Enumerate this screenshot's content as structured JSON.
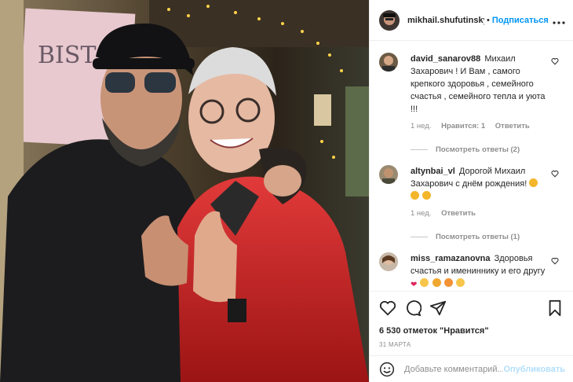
{
  "header": {
    "username": "mikhail.shufutinsky",
    "separator": "•",
    "follow_label": "Подписаться",
    "more_icon": "more-horizontal-icon"
  },
  "comments": [
    {
      "username": "david_sanarov88",
      "text": "Михаил Захарович ! И Вам , самого крепкого здоровья , семейного счастья , семейного тепла и уюта !!!",
      "time": "1 нед.",
      "likes": "Нравится: 1",
      "reply": "Ответить",
      "replies": "Посмотреть ответы (2)"
    },
    {
      "username": "altynbai_vl",
      "text": "Дорогой Михаил Захарович с днём рождения!",
      "emoji": [
        "clap",
        "clap",
        "clap"
      ],
      "time": "1 нед.",
      "reply": "Ответить",
      "replies": "Посмотреть ответы (1)"
    },
    {
      "username": "miss_ramazanovna",
      "text": "Здоровья счастья и имениннику и его другу",
      "emoji": [
        "heart",
        "scream",
        "hug",
        "heart-face",
        "laugh"
      ]
    }
  ],
  "actions": {
    "icons": [
      "heart-icon",
      "comment-icon",
      "share-icon",
      "bookmark-icon"
    ],
    "likes": "6 530 отметок \"Нравится\"",
    "date": "31 МАРТА"
  },
  "add_comment": {
    "placeholder": "Добавьте комментарий...",
    "publish_label": "Опубликовать"
  },
  "colors": {
    "link_blue": "#0095f6",
    "publish_disabled": "#b2dffc",
    "meta_gray": "#8e8e8e"
  }
}
